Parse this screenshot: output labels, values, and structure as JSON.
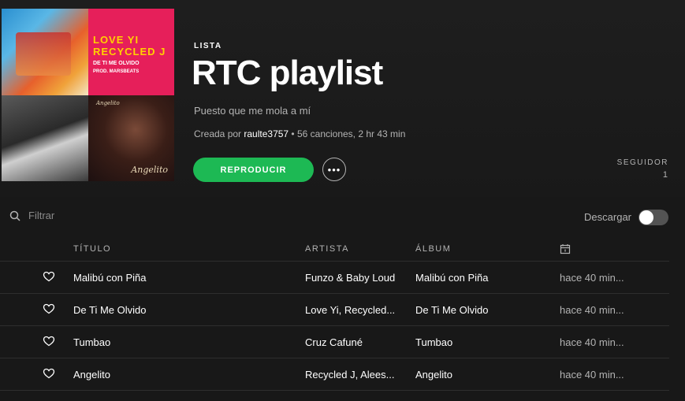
{
  "playlist": {
    "type_label": "LISTA",
    "title": "RTC playlist",
    "description": "Puesto que me mola a mí",
    "meta_prefix": "Creada por ",
    "owner": "raulte3757",
    "meta_suffix": " • 56 canciones, 2 hr 43 min",
    "play_label": "REPRODUCIR",
    "more_label": "•••",
    "followers_label": "SEGUIDOR",
    "followers_count": "1"
  },
  "cover": {
    "tile2_line1": "LOVE YI",
    "tile2_line2": "RECYCLED J",
    "tile2_line3": "DE TI ME OLVIDO",
    "tile2_line4": "PROD. MARSBEATS",
    "tile4_top": "Angelito",
    "tile4_signature": "Angelito"
  },
  "toolbar": {
    "filter_placeholder": "Filtrar",
    "download_label": "Descargar",
    "download_enabled": false
  },
  "table": {
    "columns": [
      "TÍTULO",
      "ARTISTA",
      "ÁLBUM",
      "calendar-icon"
    ],
    "rows": [
      {
        "title": "Malibú con Piña",
        "artist": "Funzo & Baby Loud",
        "album": "Malibú con Piña",
        "added": "hace 40 min..."
      },
      {
        "title": "De Ti Me Olvido",
        "artist": "Love Yi, Recycled...",
        "album": "De Ti Me Olvido",
        "added": "hace 40 min..."
      },
      {
        "title": "Tumbao",
        "artist": "Cruz Cafuné",
        "album": "Tumbao",
        "added": "hace 40 min..."
      },
      {
        "title": "Angelito",
        "artist": "Recycled J, Alees...",
        "album": "Angelito",
        "added": "hace 40 min..."
      }
    ]
  },
  "colors": {
    "accent": "#1db954",
    "background": "#181818",
    "text_secondary": "#b3b3b3"
  }
}
